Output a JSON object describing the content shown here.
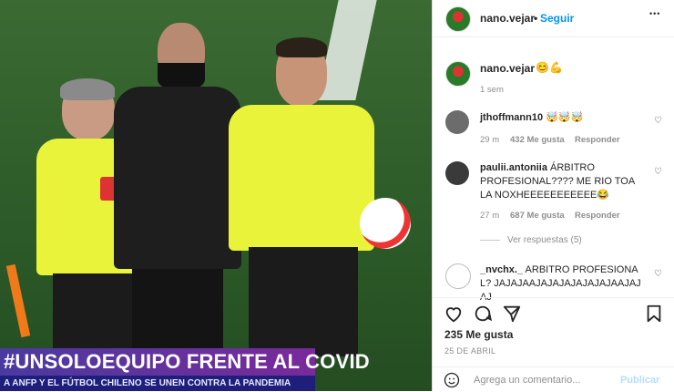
{
  "photo": {
    "banner_text": "#UNSOLOEQUIPO FRENTE AL COVID",
    "subbanner_text": "A ANFP Y EL FÚTBOL CHILENO SE UNEN CONTRA LA PANDEMIA"
  },
  "header": {
    "username": "nano.vejar",
    "separator": "•",
    "follow_label": "Seguir",
    "more_label": "•••"
  },
  "caption": {
    "username": "nano.vejar",
    "text": "😊💪",
    "time": "1 sem"
  },
  "comments": [
    {
      "username": "jthoffmann10",
      "text": "🤯🤯🤯",
      "time": "29 m",
      "likes": "432 Me gusta",
      "reply": "Responder"
    },
    {
      "username": "paulii.antoniia",
      "text": "ÁRBITRO PROFESIONAL???? ME RIO TOA LA NOXHEEEEEEEEEEE😂",
      "time": "27 m",
      "likes": "687 Me gusta",
      "reply": "Responder",
      "view_replies": "Ver respuestas (5)"
    },
    {
      "username": "_nvchx._",
      "text": "ARBITRO PROFESIONAL? JAJAJAAJAJAJAJAJAJAJAAJAJAJ"
    }
  ],
  "actions": {
    "likes": "235 Me gusta",
    "date": "25 DE ABRIL"
  },
  "comment_box": {
    "placeholder": "Agrega un comentario...",
    "publish_label": "Publicar"
  }
}
